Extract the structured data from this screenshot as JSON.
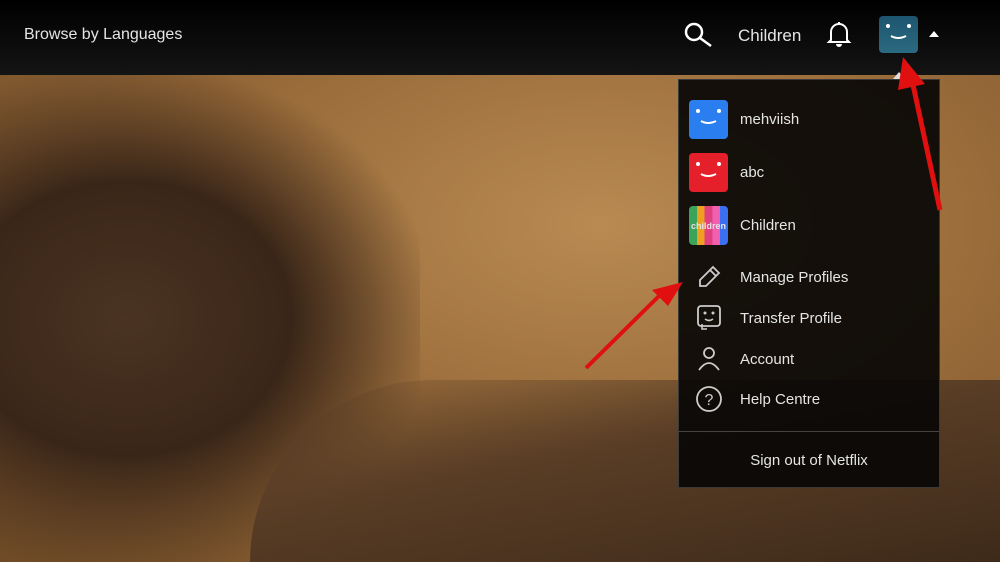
{
  "header": {
    "browse_label": "Browse by Languages",
    "current_profile": "Children"
  },
  "menu": {
    "profiles": [
      {
        "name": "mehviish",
        "color": "#2b7ef0"
      },
      {
        "name": "abc",
        "color": "#e5202b"
      },
      {
        "name": "Children",
        "color": "kids"
      }
    ],
    "actions": [
      {
        "label": "Manage Profiles",
        "icon": "pencil-icon"
      },
      {
        "label": "Transfer Profile",
        "icon": "transfer-profile-icon"
      },
      {
        "label": "Account",
        "icon": "person-icon"
      },
      {
        "label": "Help Centre",
        "icon": "help-icon"
      }
    ],
    "sign_out": "Sign out of Netflix",
    "kids_badge": "children"
  }
}
